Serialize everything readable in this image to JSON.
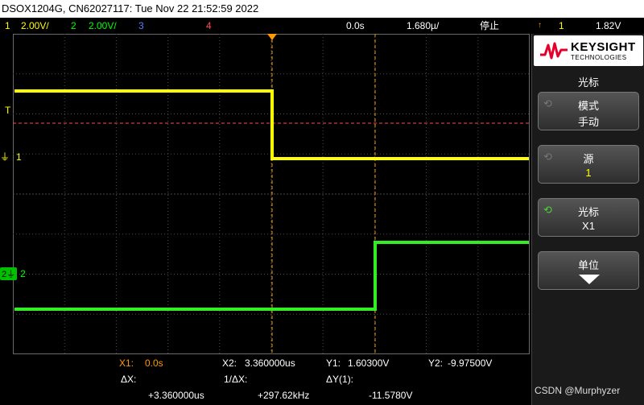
{
  "titlebar": {
    "text": "DSOX1204G, CN62027117: Tue Nov 22 21:52:59 2022"
  },
  "status": {
    "ch1_num": "1",
    "ch1_scale": "2.00V/",
    "ch2_num": "2",
    "ch2_scale": "2.00V/",
    "ch3_num": "3",
    "ch4_num": "4",
    "time_offset": "0.0s",
    "time_scale": "1.680µ/",
    "run_state": "停止",
    "trig_ch": "1",
    "trig_level": "1.82V"
  },
  "screen": {
    "trigger_marker": "T",
    "ch1_marker": "1",
    "ch2_marker": "2"
  },
  "readout": {
    "x1_label": "X1:",
    "x1_value": "0.0s",
    "x2_label": "X2:",
    "x2_value": "3.360000us",
    "y1_label": "Y1:",
    "y1_value": "1.60300V",
    "y2_label": "Y2:",
    "y2_value": "-9.97500V",
    "dx_label": "ΔX:",
    "dx_value": "+3.360000us",
    "inv_dx_label": "1/ΔX:",
    "inv_dx_value": "+297.62kHz",
    "dy_label": "ΔY(1):",
    "dy_value": "-11.5780V"
  },
  "panel": {
    "brand_name": "KEYSIGHT",
    "brand_sub": "TECHNOLOGIES",
    "title": "光标",
    "softkeys": [
      {
        "label": "模式",
        "value": "手动"
      },
      {
        "label": "源",
        "value": "1"
      },
      {
        "label": "光标",
        "value": "X1"
      },
      {
        "label": "单位",
        "value": ""
      }
    ]
  },
  "watermark": "CSDN @Murphyzer",
  "colors": {
    "ch1": "#ffff00",
    "ch2": "#00ff00",
    "cursor": "#ff9900",
    "grid": "#4a4a4a"
  }
}
